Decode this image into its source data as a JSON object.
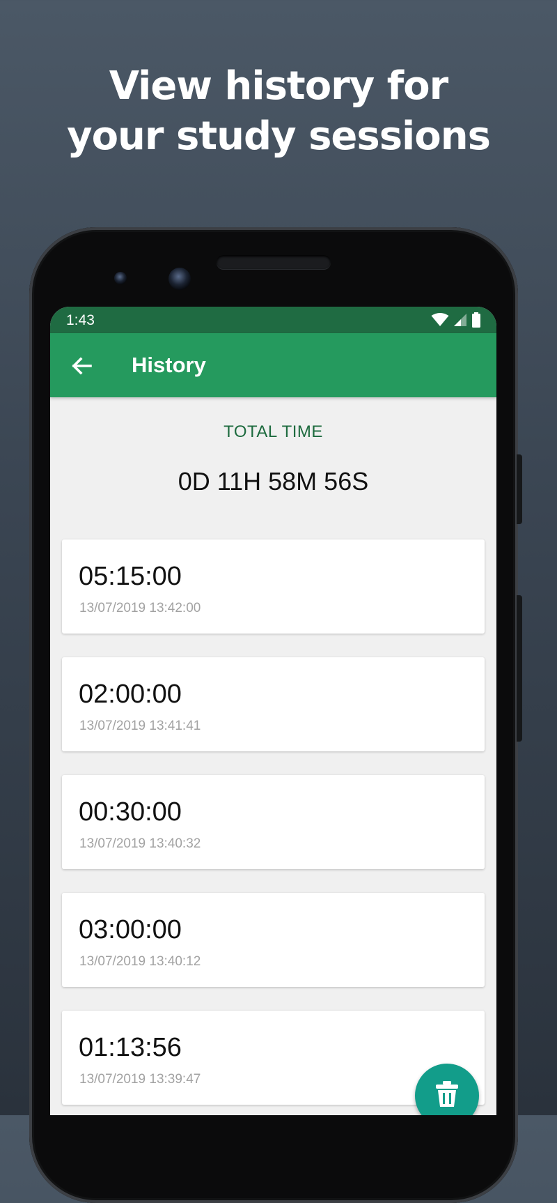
{
  "promo": {
    "line1": "View history for",
    "line2": "your study sessions"
  },
  "status_bar": {
    "time": "1:43",
    "icons": [
      "wifi-icon",
      "cell-signal-icon",
      "battery-icon"
    ]
  },
  "app_bar": {
    "title": "History",
    "back_icon": "arrow-left-icon"
  },
  "summary": {
    "label": "TOTAL TIME",
    "value": "0D 11H 58M 56S"
  },
  "sessions": [
    {
      "duration": "05:15:00",
      "date": "13/07/2019 13:42:00"
    },
    {
      "duration": "02:00:00",
      "date": "13/07/2019 13:41:41"
    },
    {
      "duration": "00:30:00",
      "date": "13/07/2019 13:40:32"
    },
    {
      "duration": "03:00:00",
      "date": "13/07/2019 13:40:12"
    },
    {
      "duration": "01:13:56",
      "date": "13/07/2019 13:39:47"
    }
  ],
  "fab": {
    "icon": "delete-sweep-icon"
  },
  "colors": {
    "status_bar": "#1f6b42",
    "app_bar": "#259a5e",
    "accent_text": "#1e6b3f",
    "fab": "#129d8a",
    "screen_bg": "#f0f0f0"
  }
}
